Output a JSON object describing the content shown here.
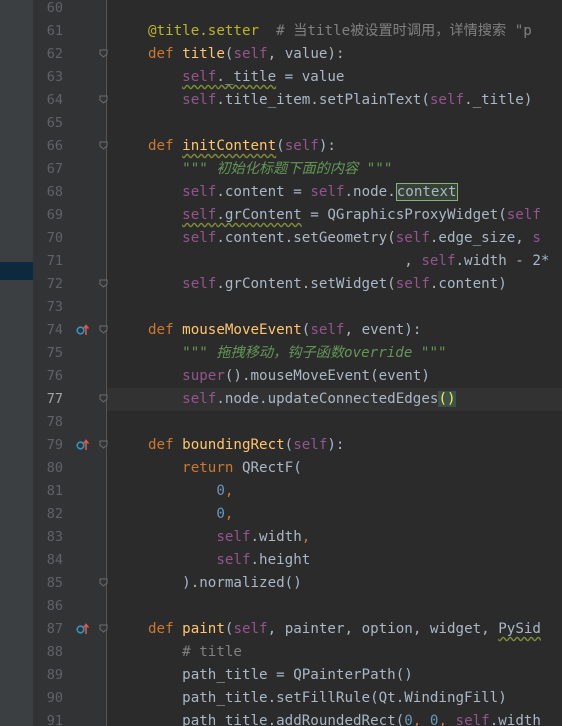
{
  "colors": {
    "background": "#2b2b2b",
    "gutter": "#313335",
    "keyword": "#cc7832",
    "self": "#94558d",
    "function": "#ffc66d",
    "string": "#629755",
    "number": "#6897bb",
    "comment": "#808080",
    "decorator": "#bbb529"
  },
  "current_line": "77",
  "lines": [
    {
      "n": "60",
      "tokens": []
    },
    {
      "n": "61",
      "tokens": [
        {
          "t": "@title.setter",
          "c": "deco"
        },
        {
          "t": "  # 当title被设置时调用，详情搜索 \"p",
          "c": "cmt"
        }
      ]
    },
    {
      "n": "62",
      "fold": true,
      "tokens": [
        {
          "t": "def ",
          "c": "kw"
        },
        {
          "t": "title",
          "c": "fn"
        },
        {
          "t": "("
        },
        {
          "t": "self",
          "c": "self"
        },
        {
          "t": ", value):"
        }
      ]
    },
    {
      "n": "63",
      "tokens": [
        {
          "t": "    "
        },
        {
          "t": "self",
          "c": "self u"
        },
        {
          "t": "._title",
          "c": "u"
        },
        {
          "t": " = value"
        }
      ]
    },
    {
      "n": "64",
      "fold": true,
      "tokens": [
        {
          "t": "    "
        },
        {
          "t": "self",
          "c": "self"
        },
        {
          "t": ".title_item.setPlainText("
        },
        {
          "t": "self",
          "c": "self"
        },
        {
          "t": "._title)"
        }
      ]
    },
    {
      "n": "65",
      "tokens": []
    },
    {
      "n": "66",
      "fold": true,
      "tokens": [
        {
          "t": "def ",
          "c": "kw"
        },
        {
          "t": "initContent",
          "c": "fn u"
        },
        {
          "t": "("
        },
        {
          "t": "self",
          "c": "self"
        },
        {
          "t": "):"
        }
      ]
    },
    {
      "n": "67",
      "tokens": [
        {
          "t": "    "
        },
        {
          "t": "\"\"\" 初始化标题下面的内容 \"\"\"",
          "c": "str"
        }
      ]
    },
    {
      "n": "68",
      "tokens": [
        {
          "t": "    "
        },
        {
          "t": "self",
          "c": "self"
        },
        {
          "t": ".content = "
        },
        {
          "t": "self",
          "c": "self"
        },
        {
          "t": ".node."
        },
        {
          "t": "context",
          "c": "ctx"
        }
      ]
    },
    {
      "n": "69",
      "tokens": [
        {
          "t": "    "
        },
        {
          "t": "self",
          "c": "self u"
        },
        {
          "t": ".grContent",
          "c": "u"
        },
        {
          "t": " = QGraphicsProxyWidget("
        },
        {
          "t": "self",
          "c": "self"
        }
      ]
    },
    {
      "n": "70",
      "tokens": [
        {
          "t": "    "
        },
        {
          "t": "self",
          "c": "self"
        },
        {
          "t": ".content.setGeometry("
        },
        {
          "t": "self",
          "c": "self"
        },
        {
          "t": ".edge_size, "
        },
        {
          "t": "s",
          "c": "self"
        }
      ]
    },
    {
      "n": "71",
      "tokens": [
        {
          "t": "                              , "
        },
        {
          "t": "self",
          "c": "self"
        },
        {
          "t": ".width - 2*"
        }
      ]
    },
    {
      "n": "72",
      "fold": true,
      "tokens": [
        {
          "t": "    "
        },
        {
          "t": "self",
          "c": "self"
        },
        {
          "t": ".grContent.setWidget("
        },
        {
          "t": "self",
          "c": "self"
        },
        {
          "t": ".content)"
        }
      ]
    },
    {
      "n": "73",
      "tokens": []
    },
    {
      "n": "74",
      "override": true,
      "fold": true,
      "tokens": [
        {
          "t": "def ",
          "c": "kw"
        },
        {
          "t": "mouseMoveEvent",
          "c": "fn"
        },
        {
          "t": "("
        },
        {
          "t": "self",
          "c": "self"
        },
        {
          "t": ", event):"
        }
      ]
    },
    {
      "n": "75",
      "tokens": [
        {
          "t": "    "
        },
        {
          "t": "\"\"\" 拖拽移动，钩子函数override \"\"\"",
          "c": "str"
        }
      ]
    },
    {
      "n": "76",
      "tokens": [
        {
          "t": "    "
        },
        {
          "t": "super",
          "c": "self"
        },
        {
          "t": "().mouseMoveEvent(event)"
        }
      ]
    },
    {
      "n": "77",
      "fold": true,
      "tokens": [
        {
          "t": "    "
        },
        {
          "t": "self",
          "c": "self"
        },
        {
          "t": ".node.updateConnectedEdges"
        },
        {
          "t": "()",
          "c": "paren"
        }
      ]
    },
    {
      "n": "78",
      "tokens": []
    },
    {
      "n": "79",
      "override": true,
      "fold": true,
      "tokens": [
        {
          "t": "def ",
          "c": "kw"
        },
        {
          "t": "boundingRect",
          "c": "fn"
        },
        {
          "t": "("
        },
        {
          "t": "self",
          "c": "self"
        },
        {
          "t": "):"
        }
      ]
    },
    {
      "n": "80",
      "tokens": [
        {
          "t": "    "
        },
        {
          "t": "return ",
          "c": "kw"
        },
        {
          "t": "QRectF("
        }
      ]
    },
    {
      "n": "81",
      "tokens": [
        {
          "t": "        "
        },
        {
          "t": "0",
          "c": "num"
        },
        {
          "t": ",",
          "c": "kw"
        }
      ]
    },
    {
      "n": "82",
      "tokens": [
        {
          "t": "        "
        },
        {
          "t": "0",
          "c": "num"
        },
        {
          "t": ",",
          "c": "kw"
        }
      ]
    },
    {
      "n": "83",
      "tokens": [
        {
          "t": "        "
        },
        {
          "t": "self",
          "c": "self"
        },
        {
          "t": ".width"
        },
        {
          "t": ",",
          "c": "kw"
        }
      ]
    },
    {
      "n": "84",
      "tokens": [
        {
          "t": "        "
        },
        {
          "t": "self",
          "c": "self"
        },
        {
          "t": ".height"
        }
      ]
    },
    {
      "n": "85",
      "fold": true,
      "tokens": [
        {
          "t": "    ).normalized()"
        }
      ]
    },
    {
      "n": "86",
      "tokens": []
    },
    {
      "n": "87",
      "override": true,
      "fold": true,
      "tokens": [
        {
          "t": "def ",
          "c": "kw"
        },
        {
          "t": "paint",
          "c": "fn"
        },
        {
          "t": "("
        },
        {
          "t": "self",
          "c": "self"
        },
        {
          "t": ", painter, option, widget, "
        },
        {
          "t": "PySid",
          "c": "u"
        }
      ]
    },
    {
      "n": "88",
      "tokens": [
        {
          "t": "    "
        },
        {
          "t": "# title",
          "c": "cmt"
        }
      ]
    },
    {
      "n": "89",
      "tokens": [
        {
          "t": "    path_title = QPainterPath()"
        }
      ]
    },
    {
      "n": "90",
      "tokens": [
        {
          "t": "    path_title.setFillRule(Qt.WindingFill)"
        }
      ]
    },
    {
      "n": "91",
      "tokens": [
        {
          "t": "    path_title.addRoundedRect("
        },
        {
          "t": "0",
          "c": "num"
        },
        {
          "t": ", ",
          "c": "kw"
        },
        {
          "t": "0",
          "c": "num"
        },
        {
          "t": ", ",
          "c": "kw"
        },
        {
          "t": "self",
          "c": "self"
        },
        {
          "t": ".width"
        }
      ]
    }
  ]
}
